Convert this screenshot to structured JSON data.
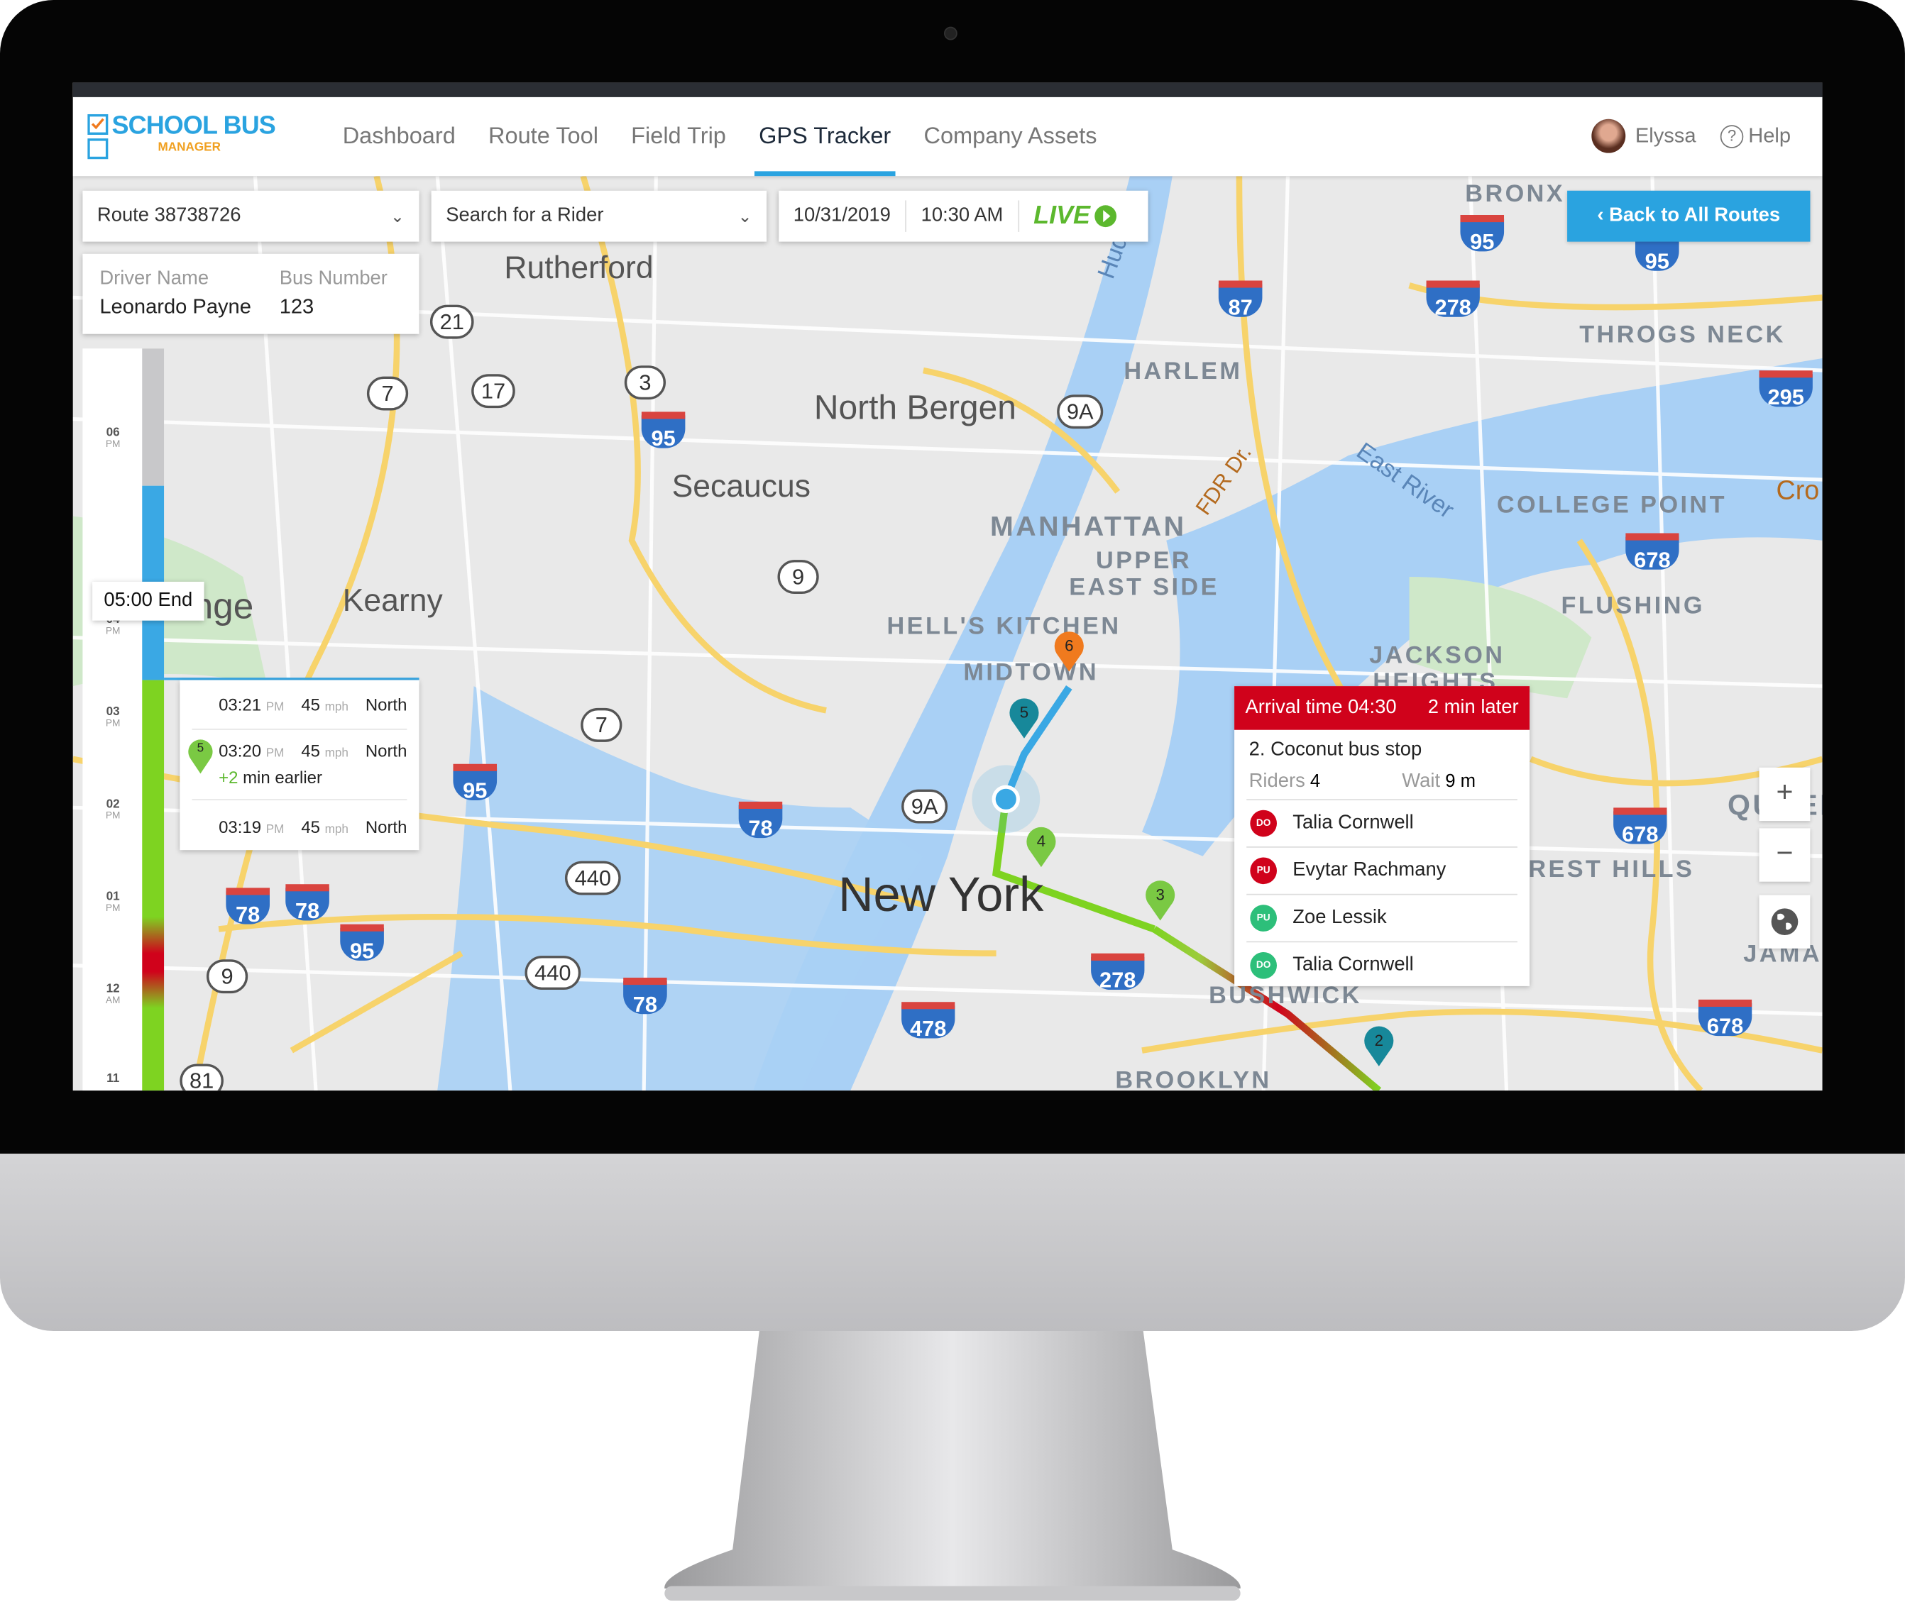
{
  "app": {
    "logo_main": "SCHOOL BUS",
    "logo_sub": "MANAGER"
  },
  "nav": {
    "items": [
      {
        "label": "Dashboard"
      },
      {
        "label": "Route Tool"
      },
      {
        "label": "Field Trip"
      },
      {
        "label": "GPS Tracker",
        "active": true
      },
      {
        "label": "Company Assets"
      }
    ]
  },
  "user": {
    "name": "Elyssa",
    "help": "Help"
  },
  "toolbar": {
    "route": "Route 38738726",
    "rider_placeholder": "Search for a Rider",
    "date": "10/31/2019",
    "time": "10:30 AM",
    "live": "LIVE",
    "back": "Back to All Routes"
  },
  "driver": {
    "name_label": "Driver Name",
    "name": "Leonardo Payne",
    "bus_label": "Bus Number",
    "bus": "123"
  },
  "timeline": {
    "end_label": "05:00 End",
    "ticks": [
      {
        "h": "06",
        "p": "PM"
      },
      {
        "h": "04",
        "p": "PM"
      },
      {
        "h": "03",
        "p": "PM"
      },
      {
        "h": "02",
        "p": "PM"
      },
      {
        "h": "01",
        "p": "PM"
      },
      {
        "h": "12",
        "p": "AM"
      },
      {
        "h": "11",
        "p": ""
      }
    ]
  },
  "history": [
    {
      "time": "03:21",
      "ampm": "PM",
      "speed": "45",
      "unit": "mph",
      "dir": "North"
    },
    {
      "time": "03:20",
      "ampm": "PM",
      "speed": "45",
      "unit": "mph",
      "dir": "North",
      "stop": "5",
      "delta": "+2",
      "note": "min earlier"
    },
    {
      "time": "03:19",
      "ampm": "PM",
      "speed": "45",
      "unit": "mph",
      "dir": "North"
    }
  ],
  "stop_popup": {
    "arrival": "Arrival time 04:30",
    "status": "2 min later",
    "name": "2. Coconut bus stop",
    "riders_label": "Riders",
    "riders": "4",
    "wait_label": "Wait",
    "wait": "9 m",
    "riders_list": [
      {
        "badge": "DO",
        "name": "Talia Cornwell",
        "color": "#d0021b"
      },
      {
        "badge": "PU",
        "name": "Evytar Rachmany",
        "color": "#d0021b"
      },
      {
        "badge": "PU",
        "name": "Zoe Lessik",
        "color": "#2dbf7a"
      },
      {
        "badge": "DO",
        "name": "Talia Cornwell",
        "color": "#2dbf7a"
      }
    ]
  },
  "map_controls": {
    "zoom_in": "+",
    "zoom_out": "−"
  },
  "map": {
    "labels": [
      "Rutherford",
      "North Bergen",
      "Secaucus",
      "Kearny",
      "range",
      "New York",
      "MANHATTAN",
      "HARLEM",
      "UPPER",
      "EAST SIDE",
      "HELL'S KITCHEN",
      "MIDTOWN",
      "BRONX",
      "THROGS NECK",
      "COLLEGE POINT",
      "FLUSHING",
      "JACKSON",
      "HEIGHTS",
      "REST HILLS",
      "QUEEN",
      "JAMA",
      "BUSHWICK",
      "BROOKLYN",
      "East River",
      "FDR Dr.",
      "Hudson",
      "Cro"
    ],
    "shields": [
      "95",
      "95",
      "95",
      "95",
      "95",
      "87",
      "278",
      "278",
      "295",
      "678",
      "678",
      "678",
      "78",
      "78",
      "78",
      "78",
      "478"
    ],
    "routes": [
      "21",
      "7",
      "17",
      "3",
      "9A",
      "9",
      "7",
      "9A",
      "440",
      "440",
      "9",
      "81"
    ]
  },
  "stops": [
    {
      "n": "6",
      "color": "#f07a1e"
    },
    {
      "n": "5",
      "color": "#17889a"
    },
    {
      "n": "4",
      "color": "#7ac943"
    },
    {
      "n": "3",
      "color": "#7ac943"
    },
    {
      "n": "2",
      "color": "#17889a"
    }
  ],
  "colors": {
    "accent": "#2aa3e0",
    "live": "#5cb82e",
    "late": "#d0021b",
    "route_done": "#7ed321",
    "route_active": "#3aa8e4"
  }
}
